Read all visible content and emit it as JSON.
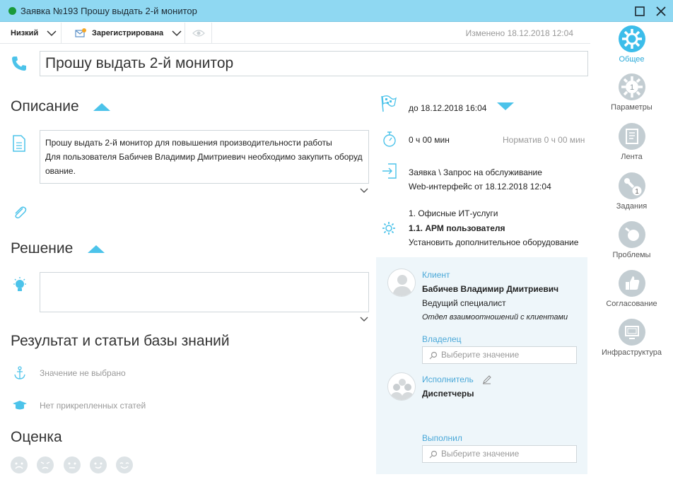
{
  "window": {
    "title": "Заявка №193 Прошу выдать 2-й монитор"
  },
  "toolbar": {
    "priority": "Низкий",
    "status": "Зарегистрирована",
    "changed": "Изменено 18.12.2018 12:04"
  },
  "subject": "Прошу выдать 2-й монитор",
  "description": {
    "title": "Описание",
    "lines": [
      "Прошу выдать 2-й монитор для повышения производительности работы",
      "Для пользователя Бабичев Владимир Дмитриевич необходимо закупить оборуд",
      "ование."
    ]
  },
  "solution": {
    "title": "Решение",
    "text": ""
  },
  "knowledge": {
    "title": "Результат и статьи базы знаний",
    "result": "Значение не выбрано",
    "articles": "Нет прикрепленных статей"
  },
  "rating": {
    "title": "Оценка"
  },
  "details": {
    "deadline": "до 18.12.2018 16:04",
    "time_spent": "0 ч 00 мин",
    "norm": "Норматив 0 ч 00 мин",
    "type": "Заявка \\ Запрос на обслуживание",
    "source": "Web-интерфейс от 18.12.2018 12:04",
    "service_level1": "1. Офисные ИТ-услуги",
    "service_level2": "1.1. АРМ пользователя",
    "service_level3": "Установить дополнительное оборудование"
  },
  "people": {
    "client_label": "Клиент",
    "client_name": "Бабичев Владимир Дмитриевич",
    "client_position": "Ведущий специалист",
    "client_department": "Отдел взаимоотношений с клиентами",
    "owner_label": "Владелец",
    "owner_placeholder": "Выберите значение",
    "executor_label": "Исполнитель",
    "executor_value": "Диспетчеры",
    "completed_label": "Выполнил",
    "completed_placeholder": "Выберите значение"
  },
  "sidebar": {
    "items": [
      {
        "label": "Общее"
      },
      {
        "label": "Параметры",
        "badge": "1"
      },
      {
        "label": "Лента"
      },
      {
        "label": "Задания",
        "badge": "1"
      },
      {
        "label": "Проблемы"
      },
      {
        "label": "Согласование"
      },
      {
        "label": "Инфраструктура"
      }
    ]
  },
  "colors": {
    "accent": "#4cc3ea",
    "titlebar": "#8fd8f2",
    "status_dot": "#1a9a3a"
  }
}
